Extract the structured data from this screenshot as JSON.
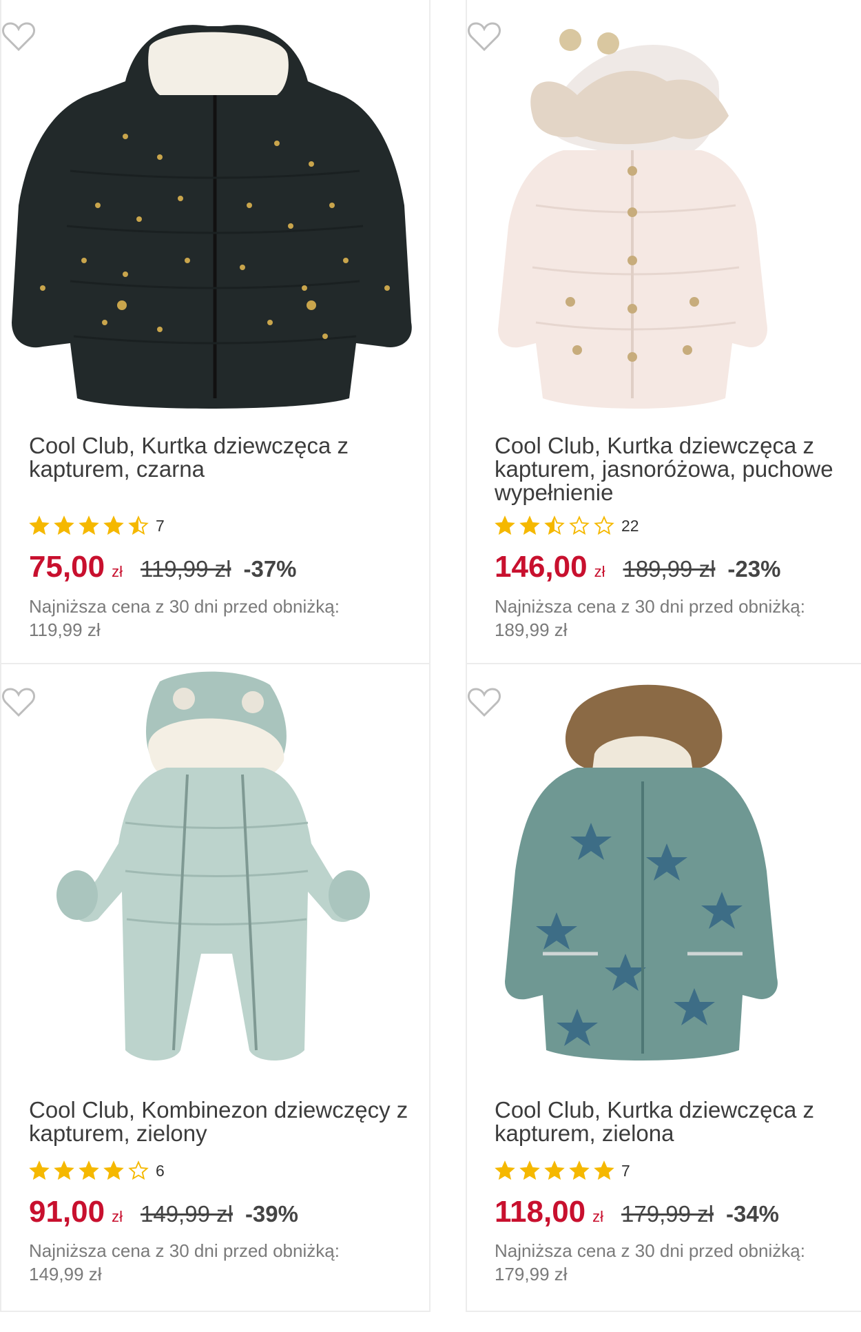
{
  "colors": {
    "price": "#c8102e",
    "star": "#f5b800",
    "border": "#ececec",
    "text": "#3c3c3c",
    "muted": "#7a7a7a"
  },
  "products": [
    {
      "title": "Cool Club, Kurtka dziewczęca z kapturem, czarna",
      "rating_value": 4.5,
      "rating_count": "7",
      "price": "75,00",
      "currency": "zł",
      "old_price": "119,99 zł",
      "discount": "-37%",
      "lowest_price_label": "Najniższa cena z 30 dni przed obniżką:",
      "lowest_price": "119,99 zł",
      "image": "black-star-puffer-jacket"
    },
    {
      "title": "Cool Club, Kurtka dziewczęca z kapturem, jasnoróżowa, puchowe wypełnienie",
      "rating_value": 2.5,
      "rating_count": "22",
      "price": "146,00",
      "currency": "zł",
      "old_price": "189,99 zł",
      "discount": "-23%",
      "lowest_price_label": "Najniższa cena z 30 dni przed obniżką:",
      "lowest_price": "189,99 zł",
      "image": "light-pink-down-jacket"
    },
    {
      "title": "Cool Club, Kombinezon dziewczęcy z kapturem, zielony",
      "rating_value": 4,
      "rating_count": "6",
      "price": "91,00",
      "currency": "zł",
      "old_price": "149,99 zł",
      "discount": "-39%",
      "lowest_price_label": "Najniższa cena z 30 dni przed obniżką:",
      "lowest_price": "149,99 zł",
      "image": "mint-snowsuit"
    },
    {
      "title": "Cool Club, Kurtka dziewczęca z kapturem, zielona",
      "rating_value": 5,
      "rating_count": "7",
      "price": "118,00",
      "currency": "zł",
      "old_price": "179,99 zł",
      "discount": "-34%",
      "lowest_price_label": "Najniższa cena z 30 dni przed obniżką:",
      "lowest_price": "179,99 zł",
      "image": "green-star-parka"
    }
  ]
}
